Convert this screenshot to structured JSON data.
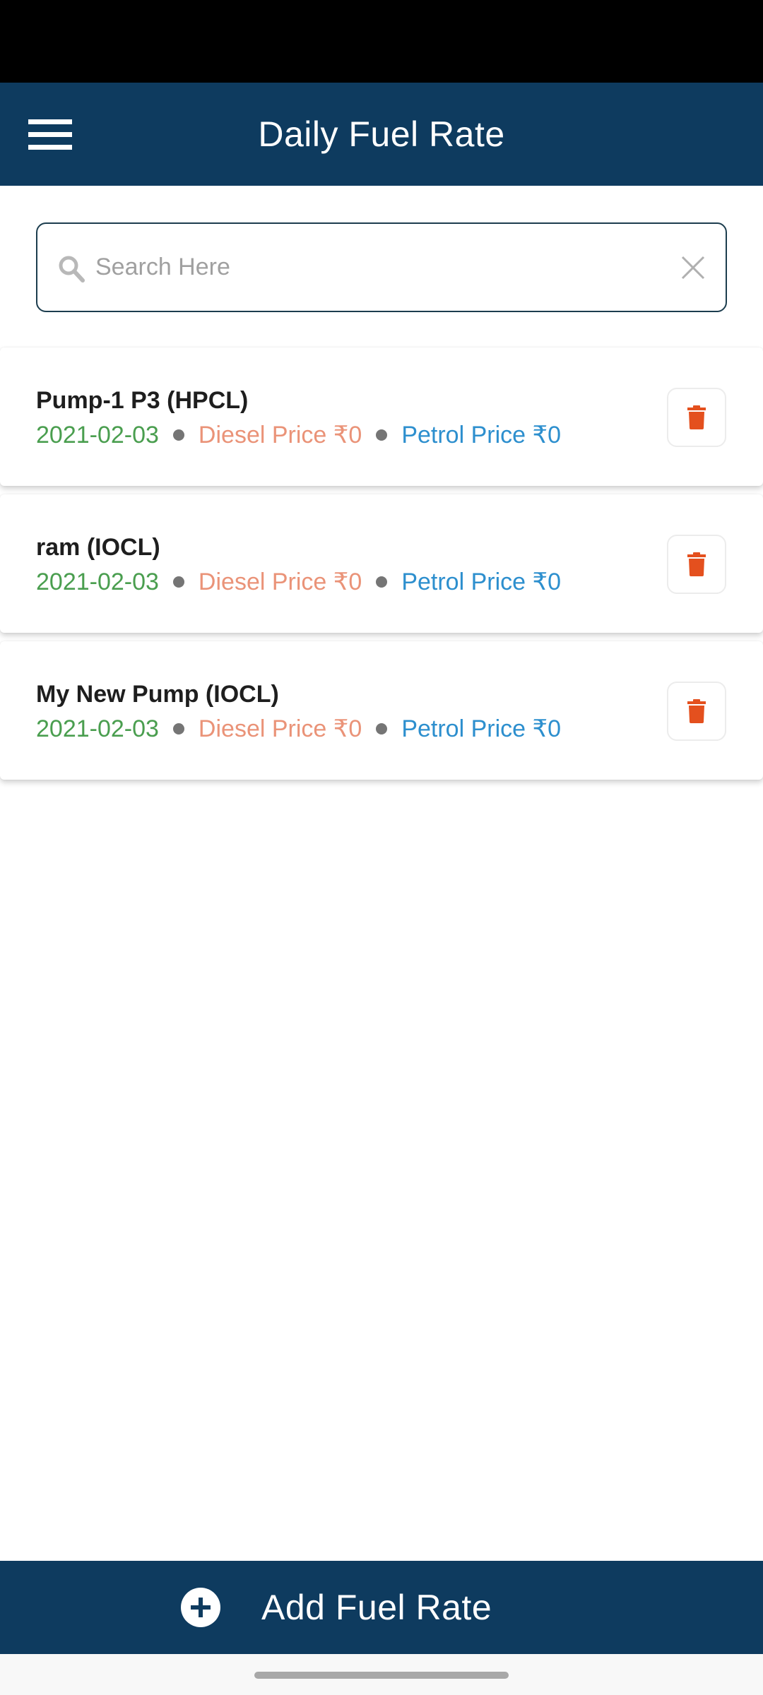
{
  "app_bar": {
    "title": "Daily Fuel Rate",
    "menu_icon": "hamburger-menu-icon",
    "background": "#0e3b5f"
  },
  "search": {
    "placeholder": "Search Here",
    "value": "",
    "search_icon": "search-icon",
    "clear_icon": "close-icon"
  },
  "colors": {
    "date": "#4a9e4f",
    "diesel": "#ea9378",
    "petrol": "#2d8fce",
    "delete": "#e4501e"
  },
  "fuel_rates": [
    {
      "name": "Pump-1 P3 (HPCL)",
      "date": "2021-02-03",
      "diesel": "Diesel Price ₹0",
      "petrol": "Petrol Price ₹0"
    },
    {
      "name": "ram (IOCL)",
      "date": "2021-02-03",
      "diesel": "Diesel Price ₹0",
      "petrol": "Petrol Price ₹0"
    },
    {
      "name": "My New Pump (IOCL)",
      "date": "2021-02-03",
      "diesel": "Diesel Price ₹0",
      "petrol": "Petrol Price ₹0"
    }
  ],
  "footer": {
    "add_label": "Add Fuel Rate",
    "add_icon": "plus-circle-icon"
  }
}
